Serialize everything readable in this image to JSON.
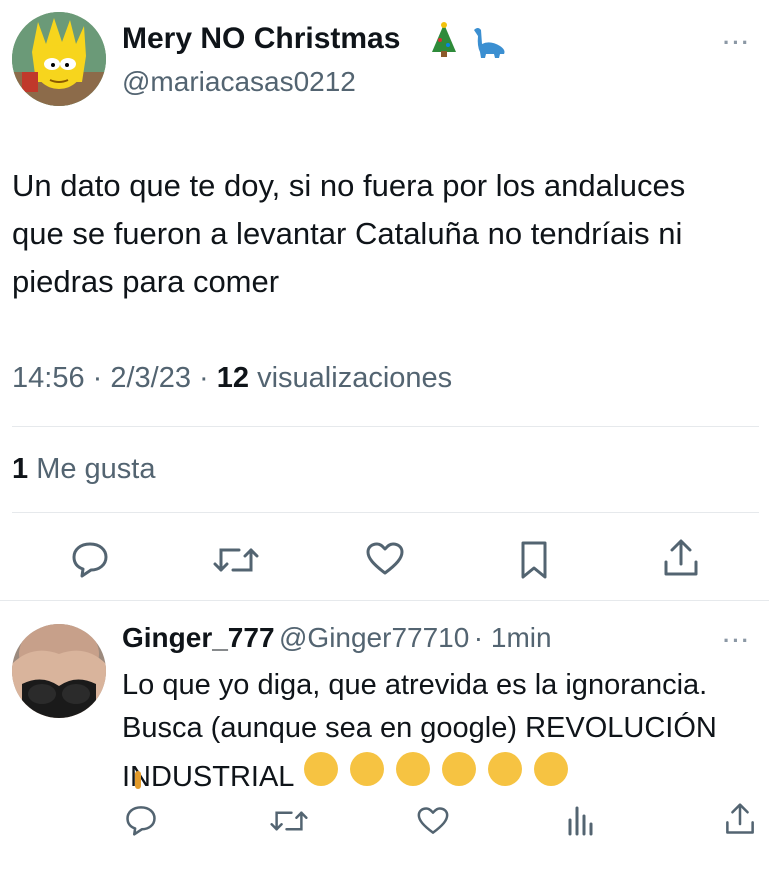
{
  "tweet": {
    "display_name": "Mery NO Christmas",
    "name_emojis": [
      "christmas-tree",
      "sauropod"
    ],
    "handle": "@mariacasas0212",
    "text": "Un dato que te doy, si no fuera por los andaluces que se fueron a levantar Cataluña no tendríais ni piedras para comer",
    "time": "14:56",
    "date": "2/3/23",
    "views_count": "12",
    "views_label": "visualizaciones",
    "likes_count": "1",
    "likes_label": "Me gusta",
    "more_glyph": "···"
  },
  "actions": {
    "icons": [
      "reply-icon",
      "retweet-icon",
      "like-icon",
      "bookmark-icon",
      "share-icon"
    ]
  },
  "reply": {
    "display_name": "Ginger_777",
    "handle": "@Ginger77710",
    "time_ago": "1min",
    "text_line1": "Lo que yo diga, que atrevida es la ignorancia.",
    "text_line2": "Busca (aunque sea en google) REVOLUCIÓN",
    "text_line3": "INDUSTRIAL",
    "emoji_count": 6,
    "more_glyph": "···",
    "action_icons": [
      "reply-icon",
      "retweet-icon",
      "like-icon",
      "views-icon",
      "share-icon"
    ]
  },
  "colors": {
    "text": "#0f1419",
    "secondary": "#536471",
    "divider": "#e6e9ec",
    "icon": "#536471"
  }
}
